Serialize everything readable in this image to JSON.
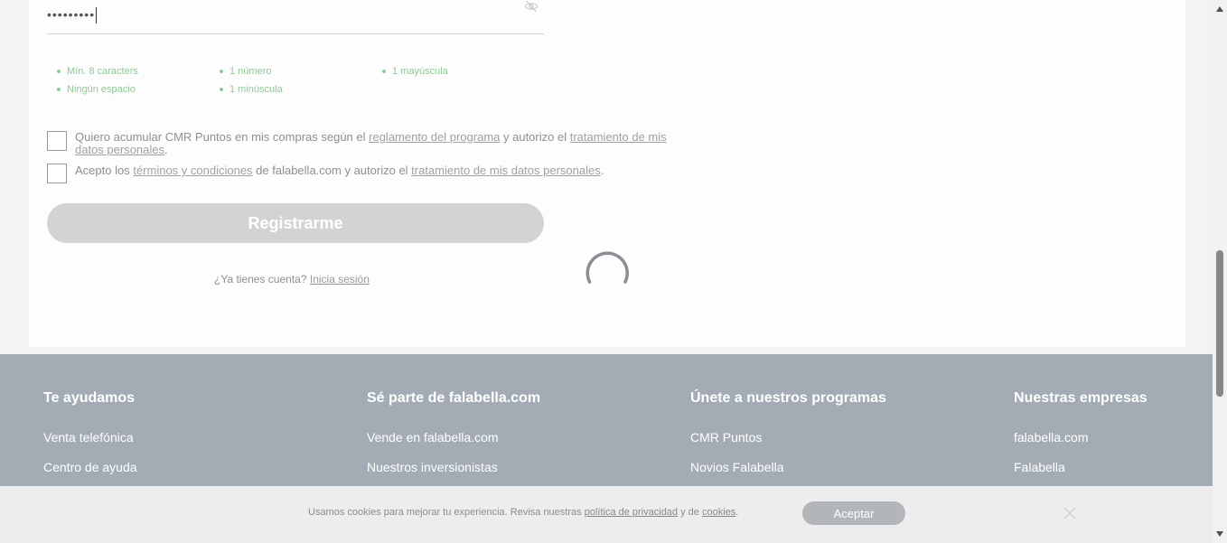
{
  "form": {
    "password_value": "•••••••••",
    "requirements": [
      "Mín. 8 caracters",
      "1 número",
      "1 mayúscula",
      "Ningún espacio",
      "1 minúscula"
    ],
    "cmr_consent": {
      "prefix": "Quiero acumular CMR Puntos en mis compras según el ",
      "link1": "reglamento del programa",
      "middle": "  y autorizo el ",
      "link2": "tratamiento de mis datos personales",
      "suffix": "."
    },
    "terms_consent": {
      "prefix": "Acepto los ",
      "link1": "términos y condiciones",
      "middle": " de falabella.com  y autorizo el ",
      "link2": "tratamiento de mis datos personales",
      "suffix": "."
    },
    "register_label": "Registrarme",
    "login_prompt": "¿Ya tienes cuenta?",
    "login_link": "Inicia sesión"
  },
  "footer": {
    "columns": [
      {
        "title": "Te ayudamos",
        "links": [
          "Venta telefónica",
          "Centro de ayuda"
        ]
      },
      {
        "title": "Sé parte de falabella.com",
        "links": [
          "Vende en falabella.com",
          "Nuestros inversionistas"
        ]
      },
      {
        "title": "Únete a nuestros programas",
        "links": [
          "CMR Puntos",
          "Novios Falabella"
        ]
      },
      {
        "title": "Nuestras empresas",
        "links": [
          "falabella.com",
          "Falabella"
        ]
      }
    ]
  },
  "cookie": {
    "text_prefix": "Usamos cookies para mejorar tu experiencia. Revisa nuestras ",
    "privacy_link": "política de privacidad",
    "text_middle": " y de ",
    "cookies_link": "cookies",
    "text_suffix": ".",
    "accept_label": "Aceptar"
  },
  "icons": {
    "password_toggle": "eye-slash-icon",
    "loading": "spinner-icon",
    "cookie_close": "close-icon"
  },
  "colors": {
    "requirement_green": "#8fc897",
    "footer_bg": "#a3acb4",
    "disabled_button": "#d3d3d3"
  }
}
